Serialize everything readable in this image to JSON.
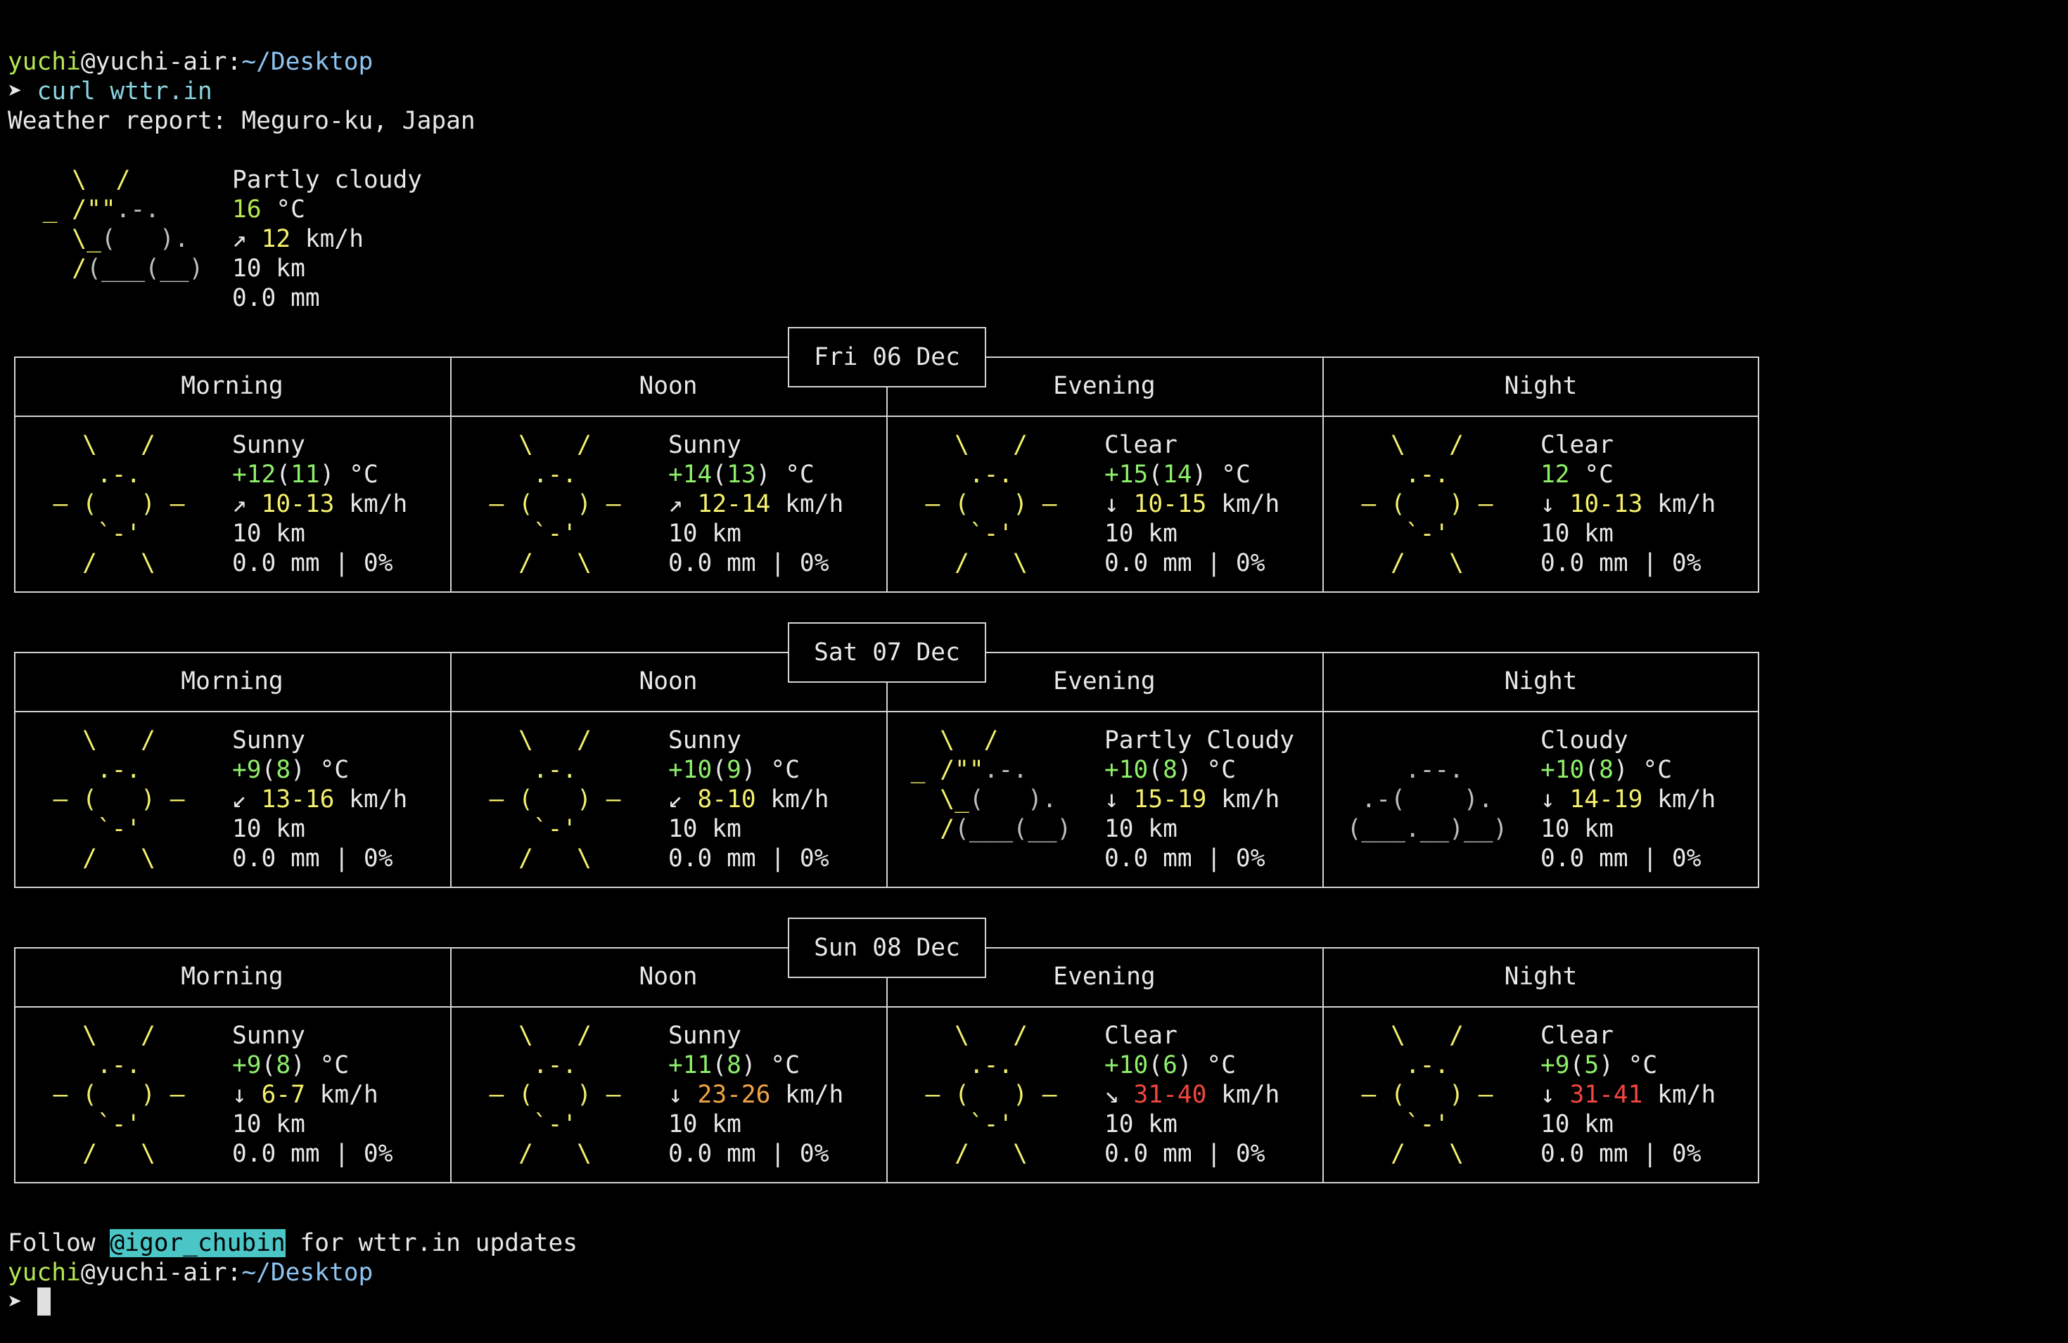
{
  "palette": {
    "bg": "#000000",
    "fg": "#e8e8e8",
    "border": "#d4d4d4",
    "user_green": "#b5e853",
    "path_blue": "#8ec5f2",
    "cmd_cyan": "#8bd5e0",
    "sun_yellow": "#f5f06b",
    "cloud_gray": "#bfbfbf",
    "temp_green": "#8ef06a",
    "wind_yellow": "#f5f06b",
    "wind_orange": "#f2a347",
    "wind_red": "#f2463e",
    "handle_bg": "#4bc6c6",
    "handle_fg": "#000000"
  },
  "prompt": {
    "user": "yuchi",
    "at_host": "@yuchi-air:",
    "path": "~/Desktop",
    "arrow": "➤ ",
    "command": "curl wttr.in"
  },
  "report_title": "Weather report: Meguro-ku, Japan",
  "current": {
    "condition": "Partly cloudy",
    "temp": "16",
    "temp_unit": " °C",
    "wind_arrow": "↗",
    "wind": "12",
    "wind_unit": " km/h",
    "visibility": "10 km",
    "precip": "0.0 mm"
  },
  "periods": [
    "Morning",
    "Noon",
    "Evening",
    "Night"
  ],
  "days": [
    {
      "date": "Fri 06 Dec",
      "slots": [
        {
          "icon": "sunny-icon",
          "art": "sun",
          "condition": "Sunny",
          "temp_prefix": "+",
          "temp": "12",
          "feels": "11",
          "temp_unit": " °C",
          "wind_arrow": "↗",
          "wind": "10-13",
          "wind_level": "yellow",
          "wind_unit": " km/h",
          "visibility": "10 km",
          "precip": "0.0 mm | 0%"
        },
        {
          "icon": "sunny-icon",
          "art": "sun",
          "condition": "Sunny",
          "temp_prefix": "+",
          "temp": "14",
          "feels": "13",
          "temp_unit": " °C",
          "wind_arrow": "↗",
          "wind": "12-14",
          "wind_level": "yellow",
          "wind_unit": " km/h",
          "visibility": "10 km",
          "precip": "0.0 mm | 0%"
        },
        {
          "icon": "clear-icon",
          "art": "sun",
          "condition": "Clear",
          "temp_prefix": "+",
          "temp": "15",
          "feels": "14",
          "temp_unit": " °C",
          "wind_arrow": "↓",
          "wind": "10-15",
          "wind_level": "yellow",
          "wind_unit": " km/h",
          "visibility": "10 km",
          "precip": "0.0 mm | 0%"
        },
        {
          "icon": "clear-icon",
          "art": "sun",
          "condition": "Clear",
          "temp_prefix": "",
          "temp": "12",
          "feels": "",
          "temp_unit": " °C",
          "wind_arrow": "↓",
          "wind": "10-13",
          "wind_level": "yellow",
          "wind_unit": " km/h",
          "visibility": "10 km",
          "precip": "0.0 mm | 0%"
        }
      ]
    },
    {
      "date": "Sat 07 Dec",
      "slots": [
        {
          "icon": "sunny-icon",
          "art": "sun",
          "condition": "Sunny",
          "temp_prefix": "+",
          "temp": "9",
          "feels": "8",
          "temp_unit": " °C",
          "wind_arrow": "↙",
          "wind": "13-16",
          "wind_level": "yellow",
          "wind_unit": " km/h",
          "visibility": "10 km",
          "precip": "0.0 mm | 0%"
        },
        {
          "icon": "sunny-icon",
          "art": "sun",
          "condition": "Sunny",
          "temp_prefix": "+",
          "temp": "10",
          "feels": "9",
          "temp_unit": " °C",
          "wind_arrow": "↙",
          "wind": "8-10",
          "wind_level": "yellow",
          "wind_unit": " km/h",
          "visibility": "10 km",
          "precip": "0.0 mm | 0%"
        },
        {
          "icon": "partly-cloudy-icon",
          "art": "partly",
          "condition": "Partly Cloudy",
          "temp_prefix": "+",
          "temp": "10",
          "feels": "8",
          "temp_unit": " °C",
          "wind_arrow": "↓",
          "wind": "15-19",
          "wind_level": "yellow",
          "wind_unit": " km/h",
          "visibility": "10 km",
          "precip": "0.0 mm | 0%"
        },
        {
          "icon": "cloudy-icon",
          "art": "cloud",
          "condition": "Cloudy",
          "temp_prefix": "+",
          "temp": "10",
          "feels": "8",
          "temp_unit": " °C",
          "wind_arrow": "↓",
          "wind": "14-19",
          "wind_level": "yellow",
          "wind_unit": " km/h",
          "visibility": "10 km",
          "precip": "0.0 mm | 0%"
        }
      ]
    },
    {
      "date": "Sun 08 Dec",
      "slots": [
        {
          "icon": "sunny-icon",
          "art": "sun",
          "condition": "Sunny",
          "temp_prefix": "+",
          "temp": "9",
          "feels": "8",
          "temp_unit": " °C",
          "wind_arrow": "↓",
          "wind": "6-7",
          "wind_level": "yellow",
          "wind_unit": " km/h",
          "visibility": "10 km",
          "precip": "0.0 mm | 0%"
        },
        {
          "icon": "sunny-icon",
          "art": "sun",
          "condition": "Sunny",
          "temp_prefix": "+",
          "temp": "11",
          "feels": "8",
          "temp_unit": " °C",
          "wind_arrow": "↓",
          "wind": "23-26",
          "wind_level": "orange",
          "wind_unit": " km/h",
          "visibility": "10 km",
          "precip": "0.0 mm | 0%"
        },
        {
          "icon": "clear-icon",
          "art": "sun",
          "condition": "Clear",
          "temp_prefix": "+",
          "temp": "10",
          "feels": "6",
          "temp_unit": " °C",
          "wind_arrow": "↘",
          "wind": "31-40",
          "wind_level": "red",
          "wind_unit": " km/h",
          "visibility": "10 km",
          "precip": "0.0 mm | 0%"
        },
        {
          "icon": "clear-icon",
          "art": "sun",
          "condition": "Clear",
          "temp_prefix": "+",
          "temp": "9",
          "feels": "5",
          "temp_unit": " °C",
          "wind_arrow": "↓",
          "wind": "31-41",
          "wind_level": "red",
          "wind_unit": " km/h",
          "visibility": "10 km",
          "precip": "0.0 mm | 0%"
        }
      ]
    }
  ],
  "art": {
    "sun": [
      "    \\   /    ",
      "     .-.     ",
      "  ― (   ) ―  ",
      "     `-'     ",
      "    /   \\    "
    ],
    "partly": [
      "   \\  /      ",
      " _ /\"\".-.    ",
      "   \\_(   ).  ",
      "   /(___(__) ",
      "             "
    ],
    "cloud": [
      "             ",
      "     .--.    ",
      "  .-(    ).  ",
      " (___.__)__) ",
      "             "
    ]
  },
  "footer": {
    "follow": "Follow ",
    "handle": "@igor_chubin",
    "rest": " for wttr.in updates"
  }
}
